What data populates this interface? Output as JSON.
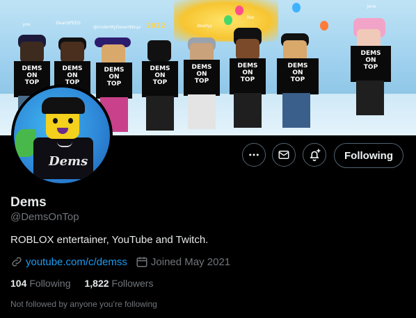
{
  "profile": {
    "display_name": "Dems",
    "handle": "@DemsOnTop",
    "bio": "ROBLOX entertainer, YouTube and Twitch.",
    "website": "youtube.com/c/demss",
    "joined": "Joined May 2021",
    "following_count": "104",
    "following_label": "Following",
    "followers_count": "1,822",
    "followers_label": "Followers",
    "mutuals_note": "Not followed by anyone you’re following"
  },
  "actions": {
    "more_icon": "more-horizontal-icon",
    "message_icon": "envelope-icon",
    "notify_icon": "bell-plus-icon",
    "follow_label": "Following"
  },
  "banner": {
    "shirt_text": [
      "DEMS",
      "ON",
      "TOP"
    ],
    "tags": [
      "yoo",
      "DeanSPEED",
      "@UnderMyDesertNinja",
      "deadyy",
      "lloo",
      "dep...",
      "ggyy",
      "Jane"
    ]
  },
  "avatar_logo": "Dems",
  "colors": {
    "accent_link": "#1d9bf0",
    "muted_text": "#71767b",
    "primary_text": "#e7e9ea",
    "background": "#000000",
    "button_border": "#536471"
  }
}
